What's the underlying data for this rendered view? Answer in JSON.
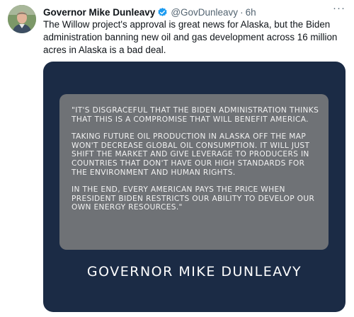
{
  "tweet": {
    "author_name": "Governor Mike Dunleavy",
    "handle": "@GovDunleavy",
    "separator": "·",
    "time": "6h",
    "more_label": "···",
    "text": "The Willow project's approval is great news for Alaska, but the Biden administration banning new oil and gas development across 16 million acres in Alaska is a bad deal.",
    "media": {
      "quote_paragraphs": [
        "\"It's disgraceful that the Biden administration thinks that this is a compromise that will benefit America.",
        "Taking future oil production in Alaska off the map won't decrease global oil consumption. It will just shift the market and give leverage to producers in countries that don't have our high standards for the environment and human rights.",
        "In the end, every American pays the price when President Biden restricts our ability to develop our own energy resources.\""
      ],
      "signature": "GOVERNOR MIKE DUNLEAVY"
    }
  },
  "colors": {
    "verified_badge": "#1d9bf0",
    "media_background": "#1b2b45",
    "quote_box": "#6f7276"
  },
  "icons": {
    "verified": "verified-badge-icon",
    "more": "more-options-icon"
  }
}
